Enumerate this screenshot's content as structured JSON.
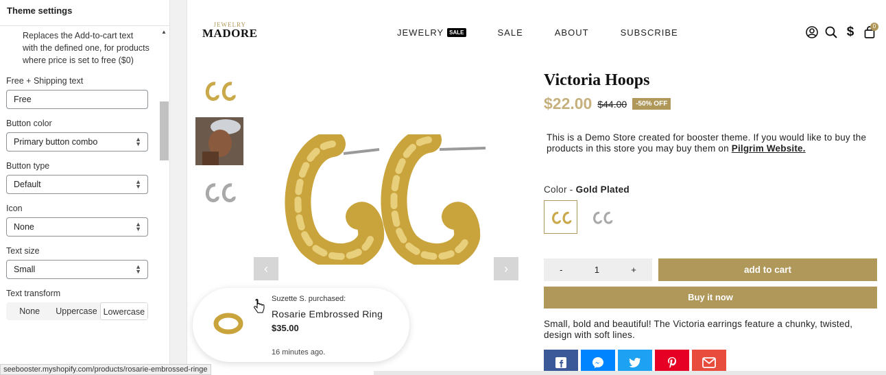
{
  "panel": {
    "title": "Theme settings",
    "help_text": "Replaces the Add-to-cart text with the defined one, for products where price is set to free ($0)",
    "free_shipping": {
      "label": "Free + Shipping text",
      "value": "Free"
    },
    "button_color": {
      "label": "Button color",
      "value": "Primary button combo"
    },
    "button_type": {
      "label": "Button type",
      "value": "Default"
    },
    "icon": {
      "label": "Icon",
      "value": "None"
    },
    "text_size": {
      "label": "Text size",
      "value": "Small"
    },
    "text_transform": {
      "label": "Text transform",
      "options": [
        "None",
        "Uppercase",
        "Lowercase"
      ],
      "selected": "Lowercase"
    }
  },
  "store": {
    "logo_top": "JEWELRY",
    "logo_main": "MADORE",
    "nav": [
      {
        "label": "JEWELRY",
        "badge": "SALE"
      },
      {
        "label": "SALE"
      },
      {
        "label": "ABOUT"
      },
      {
        "label": "SUBSCRIBE"
      }
    ],
    "icons": [
      "account-icon",
      "search-icon",
      "currency-icon",
      "cart-icon"
    ],
    "cart_count": "0",
    "currency_symbol": "$",
    "brand_color": "#b0975a"
  },
  "product": {
    "title": "Victoria Hoops",
    "price": "$22.00",
    "compare_price": "$44.00",
    "discount_badge": "-50% OFF",
    "description_pre": "This is a Demo Store created for booster theme. If you would like to buy the products in this store you may buy them on ",
    "description_link": "Pilgrim Website.",
    "color_label": "Color - ",
    "color_value": "Gold Plated",
    "qty_minus": "-",
    "qty_value": "1",
    "qty_plus": "+",
    "add_to_cart": "add to cart",
    "buy_now": "Buy it now",
    "blurb": "Small, bold and beautiful! The Victoria earrings feature a chunky, twisted, design with soft lines.",
    "share_icons": [
      "facebook-icon",
      "messenger-icon",
      "twitter-icon",
      "pinterest-icon",
      "email-icon"
    ],
    "prev_arrow": "‹",
    "next_arrow": "›"
  },
  "popup": {
    "who": "Suzette S. purchased:",
    "name": "Rosarie Embrossed Ring",
    "price": "$35.00",
    "ago": "16 minutes ago."
  },
  "statusbar": {
    "url": "seebooster.myshopify.com/products/rosarie-embrossed-ringe"
  }
}
